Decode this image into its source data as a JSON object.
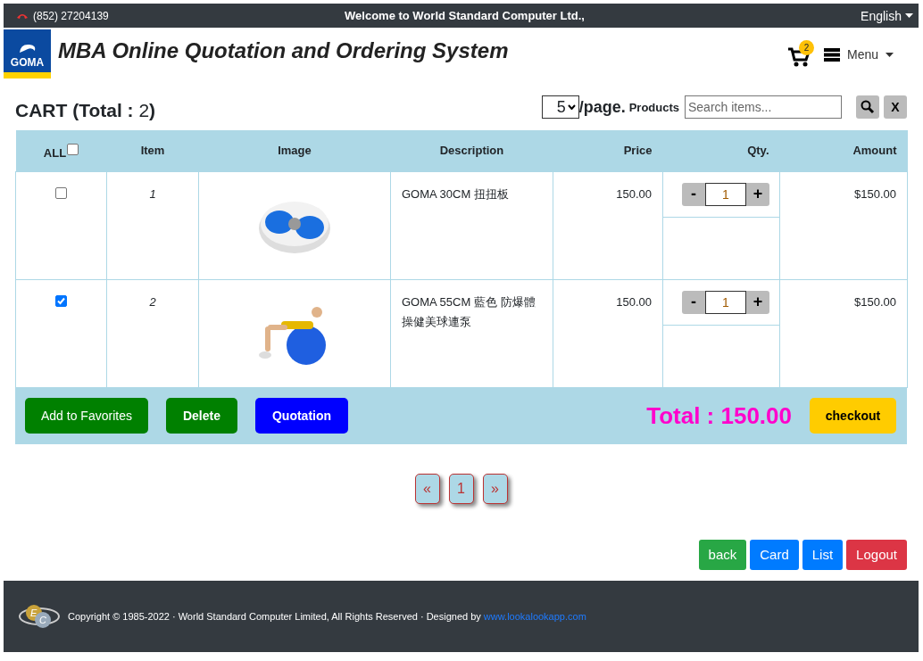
{
  "top_bar": {
    "phone": "(852) 27204139",
    "welcome": "Welcome to World Standard Computer Ltd.,",
    "language": "English"
  },
  "header": {
    "logo_text": "GOMA",
    "title": "MBA Online Quotation and Ordering System",
    "cart_count": "2",
    "menu": "Menu"
  },
  "cart": {
    "title": "CART (Total : ",
    "count": "2",
    "title_end": ")",
    "per_page": "5",
    "per_page_label": "/page.",
    "products_label": "Products",
    "search": {
      "placeholder": "Search items..."
    },
    "clear": "X"
  },
  "table": {
    "columns": [
      "ALL",
      "Item",
      "Image",
      "Description",
      "Price",
      "Qty.",
      "Amount"
    ],
    "all_checked": false,
    "rows": [
      {
        "checked": false,
        "item": "1",
        "description": "GOMA 30CM 扭扭板",
        "price": "150.00",
        "qty": "1",
        "minus": "-",
        "plus": "+",
        "amount": "$150.00"
      },
      {
        "checked": true,
        "item": "2",
        "description": "GOMA 55CM 藍色 防爆體操健美球連泵",
        "price": "150.00",
        "qty": "1",
        "minus": "-",
        "plus": "+",
        "amount": "$150.00"
      }
    ]
  },
  "actions": {
    "buttons": [
      {
        "label": "Add to Favorites",
        "kind": "favorites"
      },
      {
        "label": "Delete",
        "kind": "delete"
      },
      {
        "label": "Quotation",
        "kind": "quotation"
      }
    ],
    "total": "Total : 150.00",
    "checkout": "checkout"
  },
  "pagination": [
    "«",
    "1",
    "»"
  ],
  "nav_buttons": [
    {
      "label": "back",
      "kind": "back"
    },
    {
      "label": "Card",
      "kind": "card"
    },
    {
      "label": "List",
      "kind": "list"
    },
    {
      "label": "Logout",
      "kind": "logout"
    }
  ],
  "footer": {
    "logo_text": "EC",
    "copyright": "Copyright © 1985-2022 · World Standard Computer Limited, All Rights Reserved · Designed by ",
    "link": "www.lookalookapp.com"
  }
}
